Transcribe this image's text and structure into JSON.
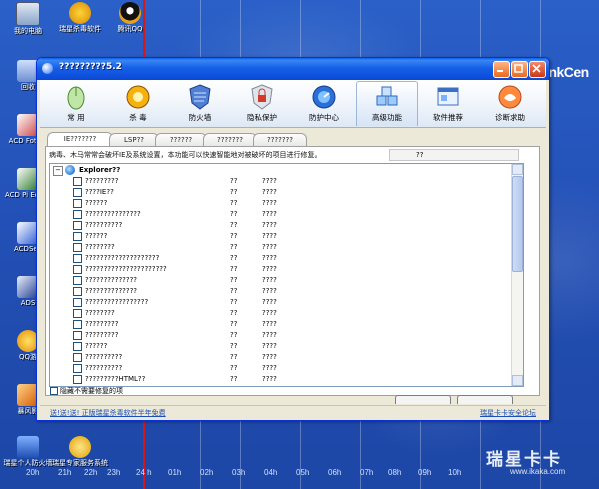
{
  "desktop": {
    "icons": [
      {
        "label": "我的电脑",
        "icon": "computer-icon"
      },
      {
        "label": "瑞星杀毒软件",
        "icon": "rising-antivirus-icon"
      },
      {
        "label": "腾讯QQ",
        "icon": "qq-penguin-icon"
      },
      {
        "label": "回收",
        "icon": "recycle-bin-icon"
      },
      {
        "label": "ACD FotoSl",
        "icon": "acd-fotoslate-icon"
      },
      {
        "label": "ACD Pi Editor",
        "icon": "acd-editor-icon"
      },
      {
        "label": "ACDSee",
        "icon": "acdsee-icon"
      },
      {
        "label": "ADS",
        "icon": "ads-icon"
      },
      {
        "label": "QQ游",
        "icon": "qq-game-icon"
      },
      {
        "label": "暴风影",
        "icon": "storm-player-icon"
      },
      {
        "label": "瑞星个人防火墙",
        "icon": "rising-firewall-icon"
      },
      {
        "label": "瑞星专家服务系统",
        "icon": "rising-expert-icon"
      }
    ],
    "wallpaper_text": "hinkCen",
    "timeline": [
      "20h",
      "21h",
      "22h",
      "23h",
      "24 h",
      "01h",
      "02h",
      "03h",
      "04h",
      "05h",
      "06h",
      "07h",
      "08h",
      "09h",
      "10h"
    ],
    "watermark": {
      "main": "瑞星卡卡",
      "url": "www.ikaka.com"
    }
  },
  "window": {
    "title": "?????????5.2",
    "toolbar": [
      {
        "label": "常 用",
        "icon": "mouse-icon"
      },
      {
        "label": "杀 毒",
        "icon": "lion-shield-icon"
      },
      {
        "label": "防火墙",
        "icon": "firewall-icon"
      },
      {
        "label": "隐私保护",
        "icon": "privacy-lock-icon"
      },
      {
        "label": "防护中心",
        "icon": "protection-center-icon"
      },
      {
        "label": "高级功能",
        "icon": "advanced-cubes-icon",
        "active": true
      },
      {
        "label": "软件推荐",
        "icon": "software-window-icon"
      },
      {
        "label": "诊断求助",
        "icon": "help-hands-icon"
      }
    ],
    "tabs": [
      {
        "label": "IE???????",
        "active": true
      },
      {
        "label": "LSP??"
      },
      {
        "label": "??????"
      },
      {
        "label": "???????"
      },
      {
        "label": "???????"
      }
    ],
    "description": "病毒、木马常常会破坏IE及系统设置，本功能可以快速智能地对被破坏的项目进行修复。",
    "desc_box": "??",
    "tree_root": "Explorer??",
    "tree_toggle": "−",
    "rows": [
      {
        "name": "?????????",
        "risk": "??",
        "status": "????"
      },
      {
        "name": "????IE??",
        "risk": "??",
        "status": "????"
      },
      {
        "name": "??????",
        "risk": "??",
        "status": "????"
      },
      {
        "name": "???????????????",
        "risk": "??",
        "status": "????"
      },
      {
        "name": "??????????",
        "risk": "??",
        "status": "????"
      },
      {
        "name": "??????",
        "risk": "??",
        "status": "????"
      },
      {
        "name": "????????",
        "risk": "??",
        "status": "????"
      },
      {
        "name": "????????????????????",
        "risk": "??",
        "status": "????"
      },
      {
        "name": "??????????????????????",
        "risk": "??",
        "status": "????"
      },
      {
        "name": "??????????????",
        "risk": "??",
        "status": "????"
      },
      {
        "name": "??????????????",
        "risk": "??",
        "status": "????"
      },
      {
        "name": "?????????????????",
        "risk": "??",
        "status": "????"
      },
      {
        "name": "????????",
        "risk": "??",
        "status": "????"
      },
      {
        "name": "?????????",
        "risk": "??",
        "status": "????"
      },
      {
        "name": "?????????",
        "risk": "??",
        "status": "????"
      },
      {
        "name": "??????",
        "risk": "??",
        "status": "????"
      },
      {
        "name": "??????????",
        "risk": "??",
        "status": "????"
      },
      {
        "name": "??????????",
        "risk": "??",
        "status": "????"
      },
      {
        "name": "?????????HTML??",
        "risk": "??",
        "status": "????"
      }
    ],
    "hide_option": "隐藏不需要修复的项",
    "status_left": "送!送!送! 正版瑞星杀毒软件半年免费",
    "status_right": "瑞星卡卡安全论坛"
  }
}
